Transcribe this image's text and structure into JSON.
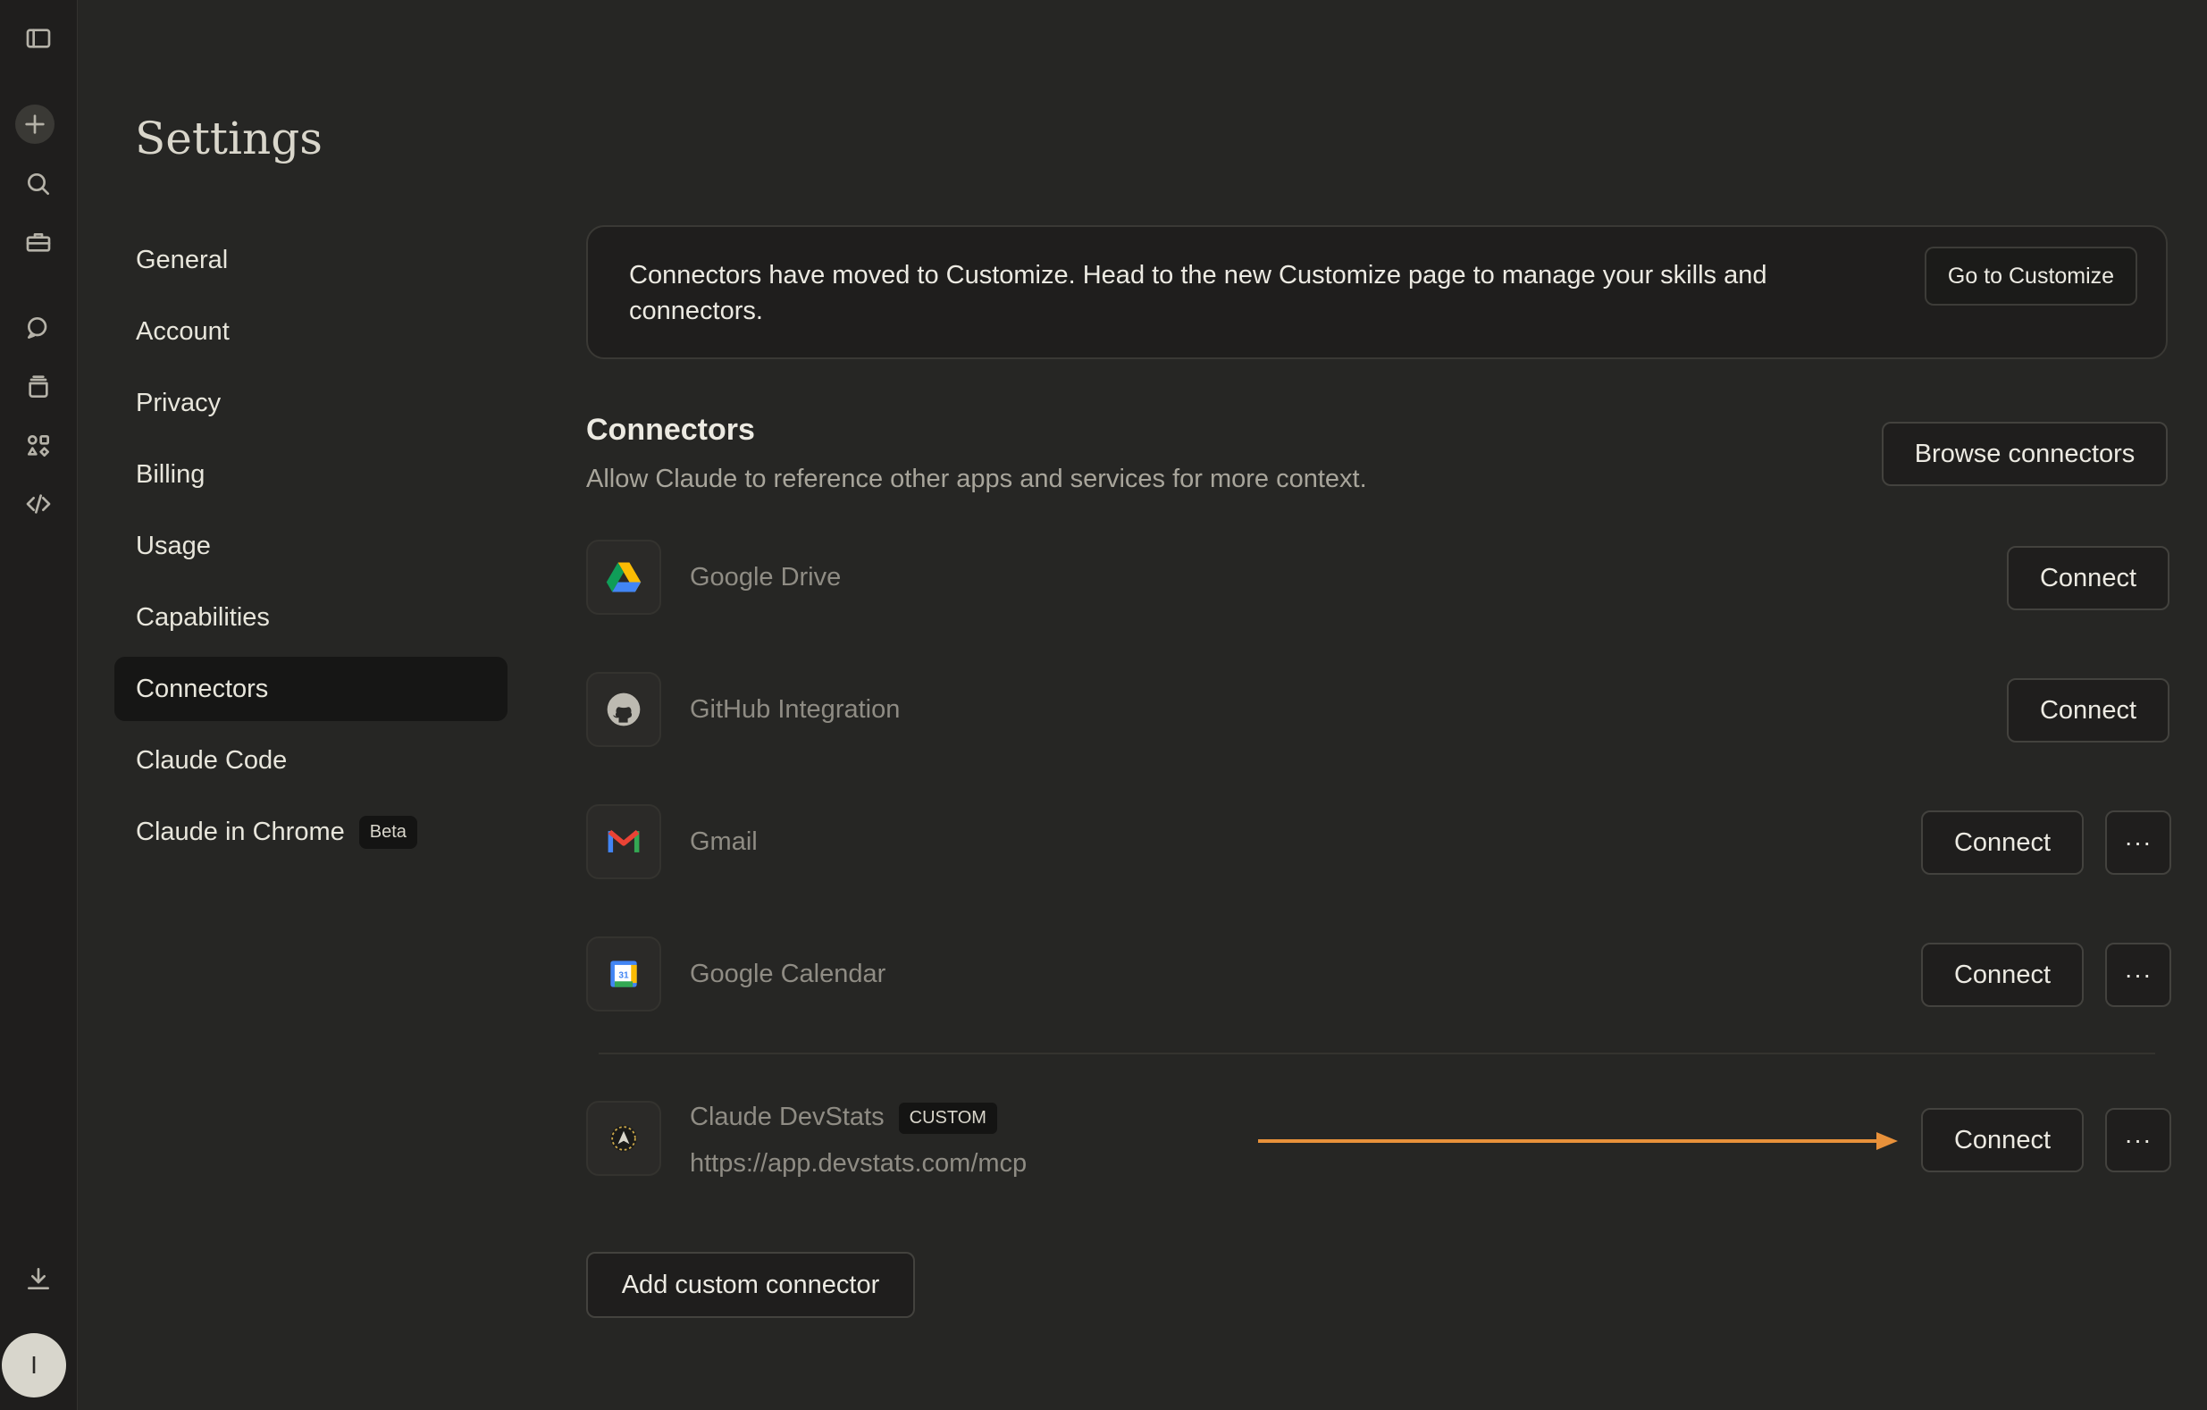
{
  "page": {
    "title": "Settings"
  },
  "nav": [
    {
      "label": "General"
    },
    {
      "label": "Account"
    },
    {
      "label": "Privacy"
    },
    {
      "label": "Billing"
    },
    {
      "label": "Usage"
    },
    {
      "label": "Capabilities"
    },
    {
      "label": "Connectors",
      "active": true
    },
    {
      "label": "Claude Code"
    },
    {
      "label": "Claude in Chrome",
      "badge": "Beta"
    }
  ],
  "notice": {
    "text": "Connectors have moved to Customize. Head to the new Customize page to manage your skills and connectors.",
    "button": "Go to Customize"
  },
  "connectors": {
    "title": "Connectors",
    "subtitle": "Allow Claude to reference other apps and services for more context.",
    "browse_label": "Browse connectors",
    "items": [
      {
        "name": "Google Drive",
        "icon": "google-drive-icon",
        "action": "Connect"
      },
      {
        "name": "GitHub Integration",
        "icon": "github-icon",
        "action": "Connect"
      },
      {
        "name": "Gmail",
        "icon": "gmail-icon",
        "action": "Connect",
        "more": "···"
      },
      {
        "name": "Google Calendar",
        "icon": "google-calendar-icon",
        "action": "Connect",
        "more": "···"
      }
    ],
    "custom": {
      "name": "Claude DevStats",
      "badge": "CUSTOM",
      "url": "https://app.devstats.com/mcp",
      "action": "Connect",
      "more": "···",
      "arrow_color": "#e8913a"
    },
    "add_label": "Add custom connector"
  },
  "user": {
    "initial": "I"
  }
}
